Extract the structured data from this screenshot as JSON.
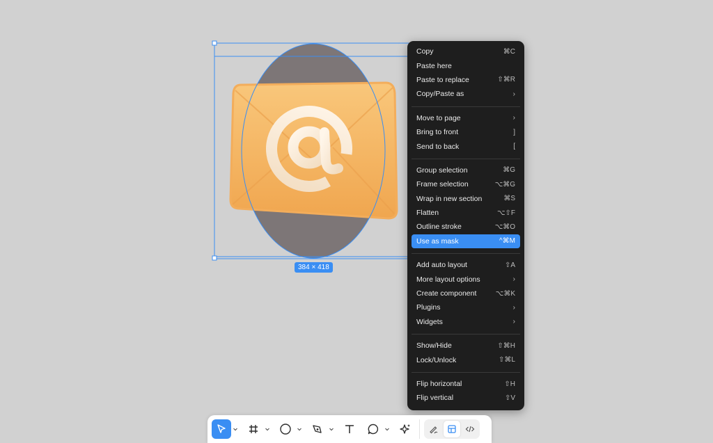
{
  "selection": {
    "size_label": "384 × 418"
  },
  "context_menu": {
    "groups": [
      [
        {
          "label": "Copy",
          "shortcut": "⌘C"
        },
        {
          "label": "Paste here",
          "shortcut": ""
        },
        {
          "label": "Paste to replace",
          "shortcut": "⇧⌘R"
        },
        {
          "label": "Copy/Paste as",
          "shortcut": "›"
        }
      ],
      [
        {
          "label": "Move to page",
          "shortcut": "›"
        },
        {
          "label": "Bring to front",
          "shortcut": "]"
        },
        {
          "label": "Send to back",
          "shortcut": "["
        }
      ],
      [
        {
          "label": "Group selection",
          "shortcut": "⌘G"
        },
        {
          "label": "Frame selection",
          "shortcut": "⌥⌘G"
        },
        {
          "label": "Wrap in new section",
          "shortcut": "⌘S"
        },
        {
          "label": "Flatten",
          "shortcut": "⌥⇧F"
        },
        {
          "label": "Outline stroke",
          "shortcut": "⌥⌘O"
        },
        {
          "label": "Use as mask",
          "shortcut": "^⌘M"
        }
      ],
      [
        {
          "label": "Add auto layout",
          "shortcut": "⇧A"
        },
        {
          "label": "More layout options",
          "shortcut": "›"
        },
        {
          "label": "Create component",
          "shortcut": "⌥⌘K"
        },
        {
          "label": "Plugins",
          "shortcut": "›"
        },
        {
          "label": "Widgets",
          "shortcut": "›"
        }
      ],
      [
        {
          "label": "Show/Hide",
          "shortcut": "⇧⌘H"
        },
        {
          "label": "Lock/Unlock",
          "shortcut": "⇧⌘L"
        }
      ],
      [
        {
          "label": "Flip horizontal",
          "shortcut": "⇧H"
        },
        {
          "label": "Flip vertical",
          "shortcut": "⇧V"
        }
      ]
    ],
    "highlighted_item": "Use as mask"
  },
  "toolbar": {
    "tools": [
      {
        "name": "move-tool",
        "icon": "cursor-arrow-icon",
        "active": true
      },
      {
        "name": "frame-tool",
        "icon": "hash-frame-icon",
        "active": false
      },
      {
        "name": "shape-tool",
        "icon": "circle-icon",
        "active": false
      },
      {
        "name": "pen-tool",
        "icon": "pen-icon",
        "active": false
      },
      {
        "name": "text-tool",
        "icon": "text-t-icon",
        "active": false
      },
      {
        "name": "comment-tool",
        "icon": "speech-bubble-icon",
        "active": false
      },
      {
        "name": "actions-tool",
        "icon": "sparkle-icon",
        "active": false
      }
    ],
    "modes": [
      {
        "name": "draw-mode",
        "icon": "pencil-squiggle-icon",
        "active": false
      },
      {
        "name": "design-mode",
        "icon": "design-layout-icon",
        "active": true
      },
      {
        "name": "dev-mode",
        "icon": "code-brackets-icon",
        "active": false
      }
    ]
  },
  "colors": {
    "accent": "#3a8ef3",
    "menu_bg": "#1e1e1e",
    "canvas_bg": "#d1d1d1",
    "ellipse_fill": "#7d7677",
    "envelope": "#f7b865"
  }
}
